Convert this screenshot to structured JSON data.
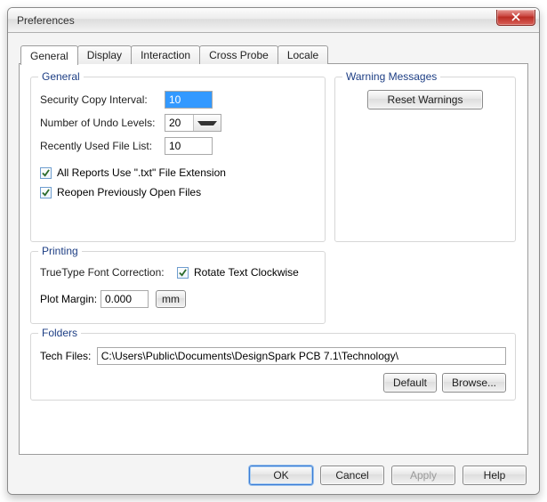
{
  "window": {
    "title": "Preferences"
  },
  "tabs": [
    "General",
    "Display",
    "Interaction",
    "Cross Probe",
    "Locale"
  ],
  "active_tab": 0,
  "general": {
    "legend": "General",
    "security_label": "Security Copy Interval:",
    "security_value": "10",
    "undo_label": "Number of Undo Levels:",
    "undo_value": "20",
    "recent_label": "Recently Used File List:",
    "recent_value": "10",
    "cb_txt_ext": "All Reports Use \".txt\" File Extension",
    "cb_reopen": "Reopen Previously Open Files"
  },
  "warning": {
    "legend": "Warning Messages",
    "reset_btn": "Reset Warnings"
  },
  "printing": {
    "legend": "Printing",
    "ttf_label": "TrueType Font Correction:",
    "rotate_label": "Rotate Text Clockwise",
    "margin_label": "Plot Margin:",
    "margin_value": "0.000",
    "unit_btn": "mm"
  },
  "folders": {
    "legend": "Folders",
    "tech_label": "Tech Files:",
    "tech_path": "C:\\Users\\Public\\Documents\\DesignSpark PCB 7.1\\Technology\\",
    "default_btn": "Default",
    "browse_btn": "Browse..."
  },
  "buttons": {
    "ok": "OK",
    "cancel": "Cancel",
    "apply": "Apply",
    "help": "Help"
  }
}
